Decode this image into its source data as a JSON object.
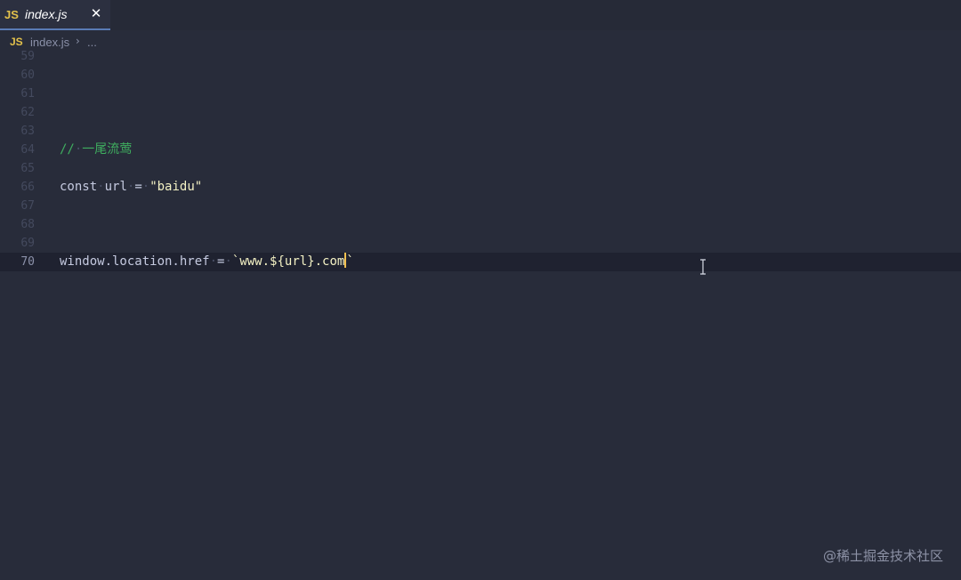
{
  "tab": {
    "badge": "JS",
    "label": "index.js",
    "close": "✕"
  },
  "breadcrumb": {
    "badge": "JS",
    "file": "index.js",
    "separator": "›",
    "more": "..."
  },
  "lines": [
    {
      "num": "59",
      "text": ""
    },
    {
      "num": "60",
      "text": ""
    },
    {
      "num": "61",
      "text": ""
    },
    {
      "num": "62",
      "text": ""
    },
    {
      "num": "63",
      "text": ""
    },
    {
      "num": "64",
      "comment_prefix": "//",
      "comment_text": "一尾流莺"
    },
    {
      "num": "65",
      "text": ""
    },
    {
      "num": "66",
      "keyword": "const",
      "ident": "url",
      "op": "=",
      "string": "\"baidu\""
    },
    {
      "num": "67",
      "text": ""
    },
    {
      "num": "68",
      "text": ""
    },
    {
      "num": "69",
      "text": ""
    },
    {
      "num": "70",
      "lhs": "window.location.href",
      "op": "=",
      "tpl_open": "`",
      "tpl_body": "www.${url}.com",
      "tpl_close": "`"
    }
  ],
  "watermark": "@稀土掘金技术社区",
  "colors": {
    "background": "#282c3a",
    "comment": "#3fae5f",
    "string": "#f3f1c4",
    "js_badge": "#e3c14b",
    "cursor": "#f3c04f"
  }
}
